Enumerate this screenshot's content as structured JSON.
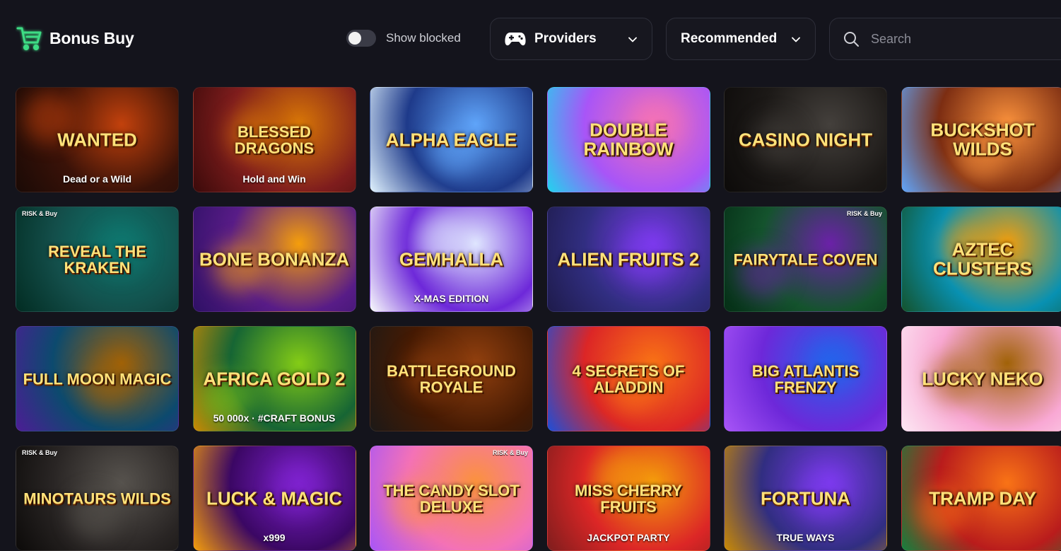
{
  "header": {
    "brand": {
      "label": "Bonus Buy",
      "icon": "cart-icon",
      "accent": "#3ddc84"
    },
    "toggle": {
      "label": "Show blocked",
      "on": false
    },
    "providers": {
      "label": "Providers",
      "icon": "gamepad-icon"
    },
    "sort": {
      "label": "Recommended"
    },
    "search": {
      "placeholder": "Search",
      "value": ""
    }
  },
  "games": [
    {
      "title": "Wanted",
      "subtitle": "Dead or a Wild",
      "badge": "",
      "bg": [
        "#3a1208",
        "#c2410c",
        "#1a0a06"
      ]
    },
    {
      "title": "Blessed Dragons",
      "subtitle": "Hold and Win",
      "badge": "",
      "bg": [
        "#7f1d1d",
        "#d97706",
        "#3b0a0a"
      ]
    },
    {
      "title": "Alpha Eagle",
      "subtitle": "",
      "badge": "",
      "bg": [
        "#1e3a8a",
        "#60a5fa",
        "#e0f2fe"
      ]
    },
    {
      "title": "Double Rainbow",
      "subtitle": "",
      "badge": "",
      "bg": [
        "#a855f7",
        "#f472b6",
        "#22d3ee"
      ]
    },
    {
      "title": "Casino Night",
      "subtitle": "",
      "badge": "",
      "bg": [
        "#1c1917",
        "#44403c",
        "#0c0a09"
      ]
    },
    {
      "title": "Buckshot Wilds",
      "subtitle": "",
      "badge": "",
      "bg": [
        "#7c2d12",
        "#fb923c",
        "#60a5fa"
      ]
    },
    {
      "title": "Reveal the Kraken",
      "subtitle": "",
      "badge": "RISK & Buy",
      "bg": [
        "#134e4a",
        "#0f766e",
        "#022c22"
      ]
    },
    {
      "title": "Bone Bonanza",
      "subtitle": "",
      "badge": "",
      "bg": [
        "#581c87",
        "#f59e0b",
        "#2e1065"
      ]
    },
    {
      "title": "Gemhalla",
      "subtitle": "X-MAS EDITION",
      "badge": "",
      "bg": [
        "#6d28d9",
        "#e0e7ff",
        "#f8fafc"
      ]
    },
    {
      "title": "Alien Fruits 2",
      "subtitle": "",
      "badge": "",
      "bg": [
        "#312e81",
        "#7c3aed",
        "#1e1b4b"
      ]
    },
    {
      "title": "Fairytale Coven",
      "subtitle": "",
      "badge": "RISK & Buy",
      "bg": [
        "#14532d",
        "#6b21a8",
        "#052e16"
      ]
    },
    {
      "title": "Aztec Clusters",
      "subtitle": "",
      "badge": "",
      "bg": [
        "#0891b2",
        "#f59e0b",
        "#14532d"
      ]
    },
    {
      "title": "Full Moon Magic",
      "subtitle": "",
      "badge": "",
      "bg": [
        "#0c4a6e",
        "#a16207",
        "#4c1d95"
      ]
    },
    {
      "title": "Africa Gold 2",
      "subtitle": "50 000x · #CRAFT BONUS",
      "badge": "",
      "bg": [
        "#166534",
        "#84cc16",
        "#ca8a04"
      ]
    },
    {
      "title": "Battleground Royale",
      "subtitle": "",
      "badge": "",
      "bg": [
        "#451a03",
        "#92400e",
        "#1c1917"
      ]
    },
    {
      "title": "4 secrets of Aladdin",
      "subtitle": "",
      "badge": "",
      "bg": [
        "#dc2626",
        "#f97316",
        "#1d4ed8"
      ]
    },
    {
      "title": "Big Atlantis Frenzy",
      "subtitle": "",
      "badge": "",
      "bg": [
        "#6d28d9",
        "#2563eb",
        "#a855f7"
      ]
    },
    {
      "title": "Lucky Neko",
      "subtitle": "",
      "badge": "",
      "bg": [
        "#f9a8d4",
        "#a16207",
        "#fce7f3"
      ]
    },
    {
      "title": "Minotaurs Wilds",
      "subtitle": "",
      "badge": "RISK & Buy",
      "bg": [
        "#292524",
        "#57534e",
        "#0c0a09"
      ]
    },
    {
      "title": "Luck & Magic",
      "subtitle": "x999",
      "badge": "",
      "bg": [
        "#3b0764",
        "#7e22ce",
        "#f59e0b"
      ]
    },
    {
      "title": "The Candy Slot Deluxe",
      "subtitle": "",
      "badge": "RISK & Buy",
      "bg": [
        "#f472b6",
        "#fb923c",
        "#a855f7"
      ]
    },
    {
      "title": "Miss Cherry Fruits",
      "subtitle": "JACKPOT PARTY",
      "badge": "",
      "bg": [
        "#dc2626",
        "#f59e0b",
        "#7f1d1d"
      ]
    },
    {
      "title": "Fortuna",
      "subtitle": "TRUE WAYS",
      "badge": "",
      "bg": [
        "#312e81",
        "#7c3aed",
        "#ca8a04"
      ]
    },
    {
      "title": "Tramp Day",
      "subtitle": "",
      "badge": "",
      "bg": [
        "#b91c1c",
        "#f97316",
        "#15803d"
      ]
    }
  ]
}
